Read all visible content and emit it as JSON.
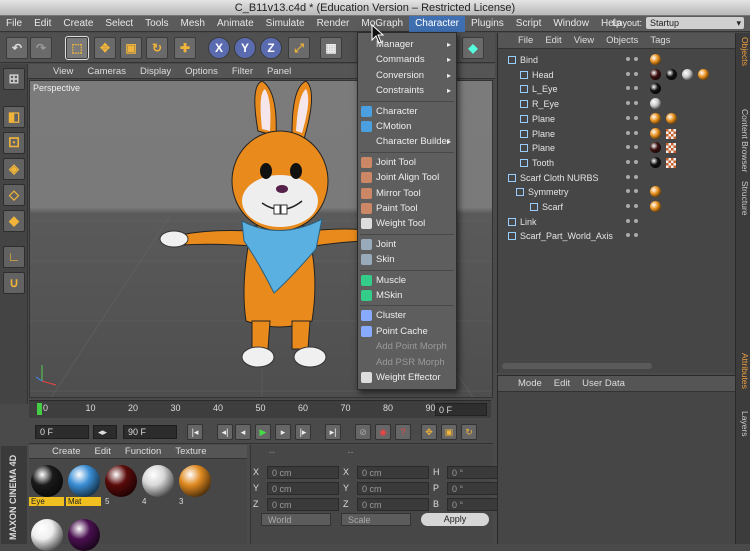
{
  "window_title": "C_B11v13.c4d * (Education Version – Restricted License)",
  "menubar": [
    "File",
    "Edit",
    "Create",
    "Select",
    "Tools",
    "Mesh",
    "Animate",
    "Simulate",
    "Render",
    "MoGraph",
    "Character",
    "Plugins",
    "Script",
    "Window",
    "Help"
  ],
  "layout": {
    "label": "Layout:",
    "value": "Startup"
  },
  "viewport_menu": [
    "View",
    "Cameras",
    "Display",
    "Options",
    "Filter",
    "Panel"
  ],
  "viewport_label": "Perspective",
  "character_menu": [
    {
      "label": "Manager",
      "submenu": true
    },
    {
      "label": "Commands",
      "submenu": true
    },
    {
      "label": "Conversion",
      "submenu": true
    },
    {
      "label": "Constraints",
      "submenu": true
    },
    {
      "label": "Character",
      "icon": "character-icon"
    },
    {
      "label": "CMotion",
      "icon": "cmotion-icon"
    },
    {
      "label": "Character Builder",
      "submenu": true
    },
    {
      "label": "Joint Tool",
      "icon": "joint-tool-icon"
    },
    {
      "label": "Joint Align Tool",
      "icon": "joint-align-icon"
    },
    {
      "label": "Mirror Tool",
      "icon": "mirror-tool-icon"
    },
    {
      "label": "Paint Tool",
      "icon": "paint-tool-icon"
    },
    {
      "label": "Weight Tool",
      "icon": "weight-tool-icon"
    },
    {
      "label": "Joint",
      "icon": "joint-icon"
    },
    {
      "label": "Skin",
      "icon": "skin-icon"
    },
    {
      "label": "Muscle",
      "icon": "muscle-icon"
    },
    {
      "label": "MSkin",
      "icon": "mskin-icon"
    },
    {
      "label": "Cluster",
      "icon": "cluster-icon"
    },
    {
      "label": "Point Cache",
      "icon": "point-cache-icon"
    },
    {
      "label": "Add Point Morph",
      "disabled": true
    },
    {
      "label": "Add PSR Morph",
      "disabled": true
    },
    {
      "label": "Weight Effector",
      "icon": "weight-effector-icon"
    }
  ],
  "object_manager": {
    "menu": [
      "File",
      "Edit",
      "View",
      "Objects",
      "Tags"
    ],
    "rows": [
      "Bind",
      "Head",
      "L_Eye",
      "R_Eye",
      "Plane",
      "Plane",
      "Plane",
      "Tooth",
      "Scarf Cloth NURBS",
      "Symmetry",
      "Scarf",
      "Link",
      "Scarf_Part_World_Axis"
    ]
  },
  "attribute_manager": {
    "menu": [
      "Mode",
      "Edit",
      "User Data"
    ]
  },
  "side_tabs": [
    "Objects",
    "Content Browser",
    "Structure",
    "Attributes",
    "Layers"
  ],
  "timeline": {
    "ticks": [
      "0",
      "10",
      "20",
      "30",
      "40",
      "50",
      "60",
      "70",
      "80",
      "90"
    ],
    "current_frame": "0 F"
  },
  "transport": {
    "start": "0 F",
    "end": "90 F"
  },
  "material_manager": {
    "menu": [
      "Create",
      "Edit",
      "Function",
      "Texture"
    ],
    "materials": [
      "Eye",
      "Mat",
      "5",
      "4",
      "3"
    ],
    "material_colors": [
      "#1a1a1a",
      "#3b8fd6",
      "#5a0a0a",
      "#d8d8d8",
      "#e08a20"
    ]
  },
  "coordinates": {
    "rows": [
      {
        "a": "X",
        "av": "0 cm",
        "b": "X",
        "bv": "0 cm",
        "c": "H",
        "cv": "0 °"
      },
      {
        "a": "Y",
        "av": "0 cm",
        "b": "Y",
        "bv": "0 cm",
        "c": "P",
        "cv": "0 °"
      },
      {
        "a": "Z",
        "av": "0 cm",
        "b": "Z",
        "bv": "0 cm",
        "c": "B",
        "cv": "0 °"
      }
    ],
    "mode1": "World",
    "mode2": "Scale",
    "apply": "Apply"
  },
  "branding": "MAXON CINEMA 4D"
}
